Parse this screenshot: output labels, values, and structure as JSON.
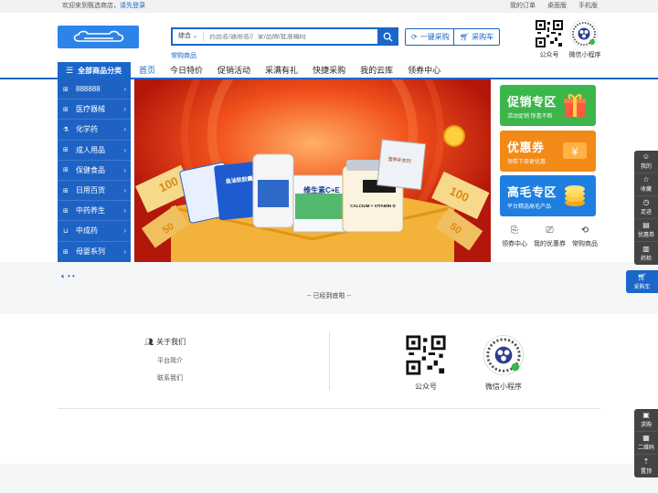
{
  "topbar": {
    "welcome": "欢迎来到甄选商店，",
    "login": "请先登录",
    "links": [
      "我的订单",
      "桌面版",
      "手机版"
    ]
  },
  "header": {
    "search_type": "综合",
    "search_placeholder": "药品名/通用名/厂家/品牌/批准编码",
    "hot_word": "常购商品",
    "quick_buy": "一键采购",
    "cart": "采购车",
    "qr_official": "公众号",
    "qr_mini": "微信小程序"
  },
  "nav": {
    "all_categories": "全部商品分类",
    "items": [
      "首页",
      "今日特价",
      "促销活动",
      "采满有礼",
      "快捷采购",
      "我的云库",
      "领券中心"
    ],
    "active_index": 0
  },
  "sidebar": {
    "items": [
      {
        "label": "888888",
        "icon": "grid-icon"
      },
      {
        "label": "医疗器械",
        "icon": "grid-icon"
      },
      {
        "label": "化学药",
        "icon": "flask-icon"
      },
      {
        "label": "成人用品",
        "icon": "grid-icon"
      },
      {
        "label": "保健食品",
        "icon": "grid-icon"
      },
      {
        "label": "日用百货",
        "icon": "grid-icon"
      },
      {
        "label": "中药养生",
        "icon": "grid-icon"
      },
      {
        "label": "中成药",
        "icon": "basket-icon"
      },
      {
        "label": "母婴系列",
        "icon": "grid-icon"
      }
    ]
  },
  "banner": {
    "product_1": "维生素C+E",
    "product_2": "CALCIUM + VITAMIN D",
    "product_3": "鱼油软胶囊",
    "product_4": "营养补充剂",
    "coin_labels": [
      "100",
      "50",
      "100",
      "50"
    ]
  },
  "promos": [
    {
      "title": "促销专区",
      "subtitle": "活动促销 惊喜不断",
      "color": "#3cb54a"
    },
    {
      "title": "优惠券",
      "subtitle": "领券下单更优惠",
      "color": "#f28a17"
    },
    {
      "title": "高毛专区",
      "subtitle": "平台精选高毛产品",
      "color": "#1f7fe0"
    }
  ],
  "mini_links": [
    "领券中心",
    "我的优惠券",
    "常购商品"
  ],
  "end_note": "-- 已经到底啦 --",
  "footer": {
    "about_title": "关于我们",
    "about_links": [
      "平台简介",
      "联系我们"
    ],
    "qr_official": "公众号",
    "qr_mini": "微信小程序"
  },
  "right_toolbar": {
    "top": [
      "我的",
      "收藏",
      "足迹",
      "优惠券",
      "药检"
    ],
    "cart": "采购车",
    "bottom": [
      "求购",
      "二维码",
      "置顶"
    ]
  },
  "colors": {
    "primary": "#1a66c9",
    "sidebar": "#1e63c4"
  }
}
